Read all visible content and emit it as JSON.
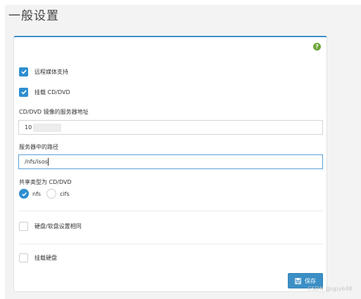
{
  "page": {
    "title": "一般设置"
  },
  "form": {
    "remote_media": {
      "label": "远程媒体支持",
      "checked": true
    },
    "mount_cd": {
      "label": "挂载 CD/DVD",
      "checked": true
    },
    "server_address": {
      "label": "CD/DVD 镜像的服务器地址",
      "value": "10"
    },
    "server_path": {
      "label": "服务器中的路径",
      "value": "/nfs/isos"
    },
    "share_type": {
      "label": "共享类型为 CD/DVD",
      "options": [
        "nfs",
        "cifs"
      ],
      "selected": "nfs"
    },
    "same_settings": {
      "label": "硬盘/软盘设置相同",
      "checked": false
    },
    "mount_hdd": {
      "label": "挂载硬盘",
      "checked": false
    },
    "save_label": "保存"
  },
  "watermark": "CSDN @qpy648"
}
